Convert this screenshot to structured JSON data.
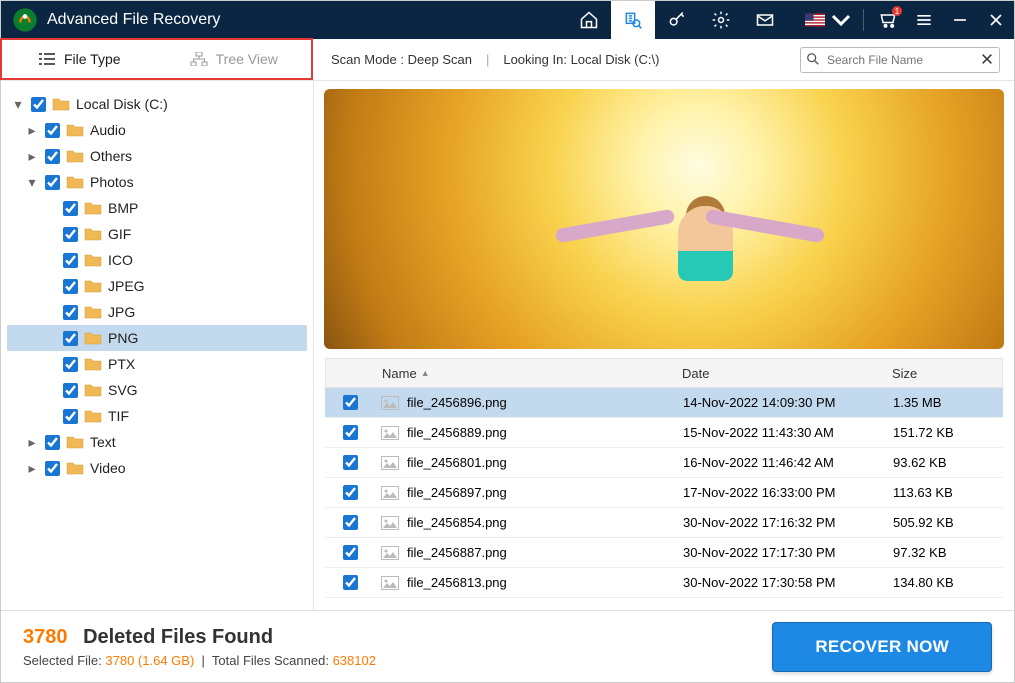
{
  "app": {
    "title": "Advanced File Recovery"
  },
  "titlebar_icons": {
    "home": "home-icon",
    "scan": "scan-icon",
    "key": "key-icon",
    "settings": "gear-icon",
    "mail": "mail-icon",
    "flag": "flag-us",
    "cart": "cart-icon",
    "menu": "menu-icon",
    "minimize": "minimize-icon",
    "close": "close-icon"
  },
  "tabs": {
    "file_type": {
      "label": "File Type",
      "icon": "list-icon"
    },
    "tree_view": {
      "label": "Tree View",
      "icon": "hierarchy-icon"
    }
  },
  "scan": {
    "mode_label": "Scan Mode :",
    "mode_value": "Deep Scan",
    "looking_label": "Looking In:",
    "looking_value": "Local Disk (C:\\)"
  },
  "search": {
    "placeholder": "Search File Name"
  },
  "tree": {
    "root": "Local Disk (C:)",
    "children": [
      {
        "label": "Audio",
        "expanded": false
      },
      {
        "label": "Others",
        "expanded": false
      },
      {
        "label": "Photos",
        "expanded": true,
        "children": [
          {
            "label": "BMP"
          },
          {
            "label": "GIF"
          },
          {
            "label": "ICO"
          },
          {
            "label": "JPEG"
          },
          {
            "label": "JPG"
          },
          {
            "label": "PNG",
            "selected": true
          },
          {
            "label": "PTX"
          },
          {
            "label": "SVG"
          },
          {
            "label": "TIF"
          }
        ]
      },
      {
        "label": "Text",
        "expanded": false
      },
      {
        "label": "Video",
        "expanded": false
      }
    ]
  },
  "table": {
    "columns": {
      "name": "Name",
      "date": "Date",
      "size": "Size"
    },
    "sort_column": "name",
    "rows": [
      {
        "name": "file_2456896.png",
        "date": "14-Nov-2022 14:09:30 PM",
        "size": "1.35 MB",
        "selected": true
      },
      {
        "name": "file_2456889.png",
        "date": "15-Nov-2022 11:43:30 AM",
        "size": "151.72 KB"
      },
      {
        "name": "file_2456801.png",
        "date": "16-Nov-2022 11:46:42 AM",
        "size": "93.62 KB"
      },
      {
        "name": "file_2456897.png",
        "date": "17-Nov-2022 16:33:00 PM",
        "size": "113.63 KB"
      },
      {
        "name": "file_2456854.png",
        "date": "30-Nov-2022 17:16:32 PM",
        "size": "505.92 KB"
      },
      {
        "name": "file_2456887.png",
        "date": "30-Nov-2022 17:17:30 PM",
        "size": "97.32 KB"
      },
      {
        "name": "file_2456813.png",
        "date": "30-Nov-2022 17:30:58 PM",
        "size": "134.80 KB"
      }
    ]
  },
  "footer": {
    "count": "3780",
    "headline_rest": "Deleted Files Found",
    "selected_label": "Selected File:",
    "selected_value": "3780 (1.64 GB)",
    "scanned_label": "Total Files Scanned:",
    "scanned_value": "638102",
    "recover_label": "RECOVER NOW"
  }
}
